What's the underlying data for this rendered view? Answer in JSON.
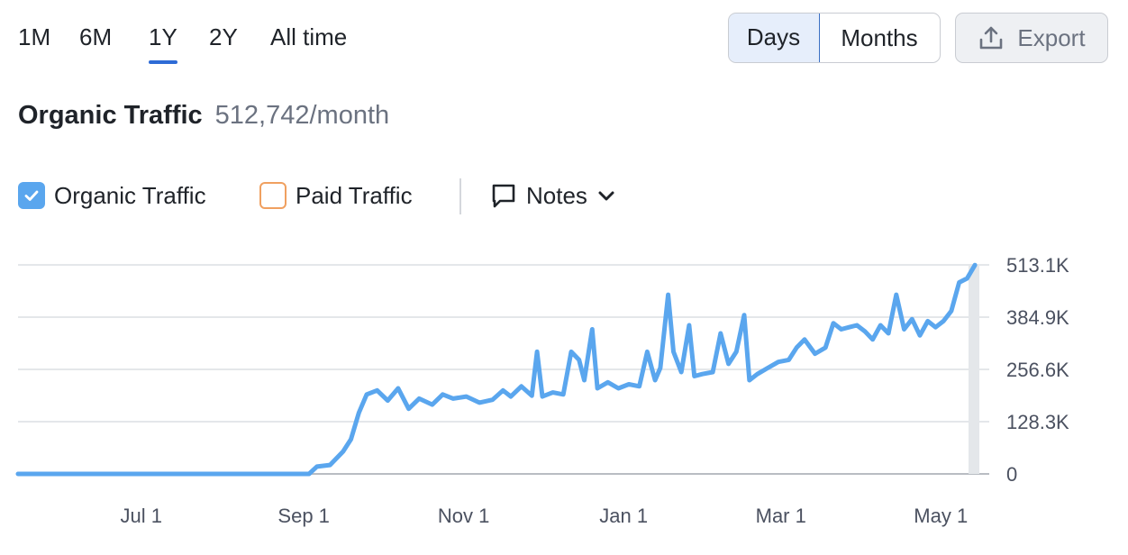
{
  "range_tabs": [
    {
      "label": "1M",
      "active": false
    },
    {
      "label": "6M",
      "active": false
    },
    {
      "label": "1Y",
      "active": true
    },
    {
      "label": "2Y",
      "active": false
    },
    {
      "label": "All time",
      "active": false
    }
  ],
  "granularity": {
    "days_label": "Days",
    "months_label": "Months",
    "selected": "Days"
  },
  "export": {
    "label": "Export",
    "icon": "upload-icon"
  },
  "header": {
    "title": "Organic Traffic",
    "value": "512,742/month"
  },
  "legend": {
    "organic": {
      "label": "Organic Traffic",
      "checked": true,
      "color": "#5aa6ee"
    },
    "paid": {
      "label": "Paid Traffic",
      "checked": false,
      "color": "#f0a060"
    },
    "notes": {
      "label": "Notes",
      "icon": "comment-icon"
    }
  },
  "chart_data": {
    "type": "line",
    "title": "",
    "xlabel": "",
    "ylabel": "",
    "ylim": [
      0,
      513100
    ],
    "y_ticks": [
      {
        "value": 0,
        "label": "0"
      },
      {
        "value": 128300,
        "label": "128.3K"
      },
      {
        "value": 256600,
        "label": "256.6K"
      },
      {
        "value": 384900,
        "label": "384.9K"
      },
      {
        "value": 513100,
        "label": "513.1K"
      }
    ],
    "x_range": [
      "2023-05-15",
      "2024-05-15"
    ],
    "x_ticks": [
      {
        "date": "2023-07-01",
        "label": "Jul 1"
      },
      {
        "date": "2023-09-01",
        "label": "Sep 1"
      },
      {
        "date": "2023-11-01",
        "label": "Nov 1"
      },
      {
        "date": "2024-01-01",
        "label": "Jan 1"
      },
      {
        "date": "2024-03-01",
        "label": "Mar 1"
      },
      {
        "date": "2024-05-01",
        "label": "May 1"
      }
    ],
    "grid": true,
    "series": [
      {
        "name": "Organic Traffic",
        "color": "#5aa6ee",
        "points": [
          [
            "2023-05-15",
            0
          ],
          [
            "2023-06-15",
            0
          ],
          [
            "2023-07-15",
            0
          ],
          [
            "2023-08-15",
            0
          ],
          [
            "2023-09-03",
            0
          ],
          [
            "2023-09-06",
            18000
          ],
          [
            "2023-09-11",
            22000
          ],
          [
            "2023-09-16",
            55000
          ],
          [
            "2023-09-19",
            85000
          ],
          [
            "2023-09-22",
            150000
          ],
          [
            "2023-09-25",
            195000
          ],
          [
            "2023-09-29",
            205000
          ],
          [
            "2023-10-03",
            180000
          ],
          [
            "2023-10-07",
            210000
          ],
          [
            "2023-10-11",
            160000
          ],
          [
            "2023-10-15",
            185000
          ],
          [
            "2023-10-20",
            170000
          ],
          [
            "2023-10-24",
            195000
          ],
          [
            "2023-10-28",
            185000
          ],
          [
            "2023-11-02",
            190000
          ],
          [
            "2023-11-07",
            175000
          ],
          [
            "2023-11-12",
            182000
          ],
          [
            "2023-11-16",
            205000
          ],
          [
            "2023-11-19",
            190000
          ],
          [
            "2023-11-23",
            215000
          ],
          [
            "2023-11-27",
            192000
          ],
          [
            "2023-11-29",
            300000
          ],
          [
            "2023-12-01",
            190000
          ],
          [
            "2023-12-05",
            200000
          ],
          [
            "2023-12-09",
            195000
          ],
          [
            "2023-12-12",
            300000
          ],
          [
            "2023-12-15",
            280000
          ],
          [
            "2023-12-17",
            230000
          ],
          [
            "2023-12-20",
            355000
          ],
          [
            "2023-12-22",
            210000
          ],
          [
            "2023-12-26",
            225000
          ],
          [
            "2023-12-30",
            210000
          ],
          [
            "2024-01-03",
            220000
          ],
          [
            "2024-01-07",
            215000
          ],
          [
            "2024-01-10",
            300000
          ],
          [
            "2024-01-13",
            230000
          ],
          [
            "2024-01-15",
            260000
          ],
          [
            "2024-01-18",
            440000
          ],
          [
            "2024-01-20",
            300000
          ],
          [
            "2024-01-23",
            250000
          ],
          [
            "2024-01-26",
            365000
          ],
          [
            "2024-01-28",
            240000
          ],
          [
            "2024-01-31",
            245000
          ],
          [
            "2024-02-04",
            250000
          ],
          [
            "2024-02-07",
            345000
          ],
          [
            "2024-02-10",
            270000
          ],
          [
            "2024-02-13",
            300000
          ],
          [
            "2024-02-16",
            390000
          ],
          [
            "2024-02-18",
            230000
          ],
          [
            "2024-02-21",
            245000
          ],
          [
            "2024-02-25",
            260000
          ],
          [
            "2024-02-29",
            275000
          ],
          [
            "2024-03-04",
            280000
          ],
          [
            "2024-03-07",
            310000
          ],
          [
            "2024-03-10",
            330000
          ],
          [
            "2024-03-14",
            295000
          ],
          [
            "2024-03-18",
            310000
          ],
          [
            "2024-03-21",
            370000
          ],
          [
            "2024-03-24",
            355000
          ],
          [
            "2024-03-27",
            360000
          ],
          [
            "2024-03-30",
            365000
          ],
          [
            "2024-04-02",
            350000
          ],
          [
            "2024-04-05",
            330000
          ],
          [
            "2024-04-08",
            365000
          ],
          [
            "2024-04-11",
            345000
          ],
          [
            "2024-04-14",
            440000
          ],
          [
            "2024-04-17",
            355000
          ],
          [
            "2024-04-20",
            380000
          ],
          [
            "2024-04-23",
            340000
          ],
          [
            "2024-04-26",
            375000
          ],
          [
            "2024-04-29",
            360000
          ],
          [
            "2024-05-02",
            375000
          ],
          [
            "2024-05-05",
            400000
          ],
          [
            "2024-05-08",
            470000
          ],
          [
            "2024-05-11",
            480000
          ],
          [
            "2024-05-14",
            512742
          ]
        ]
      }
    ]
  }
}
